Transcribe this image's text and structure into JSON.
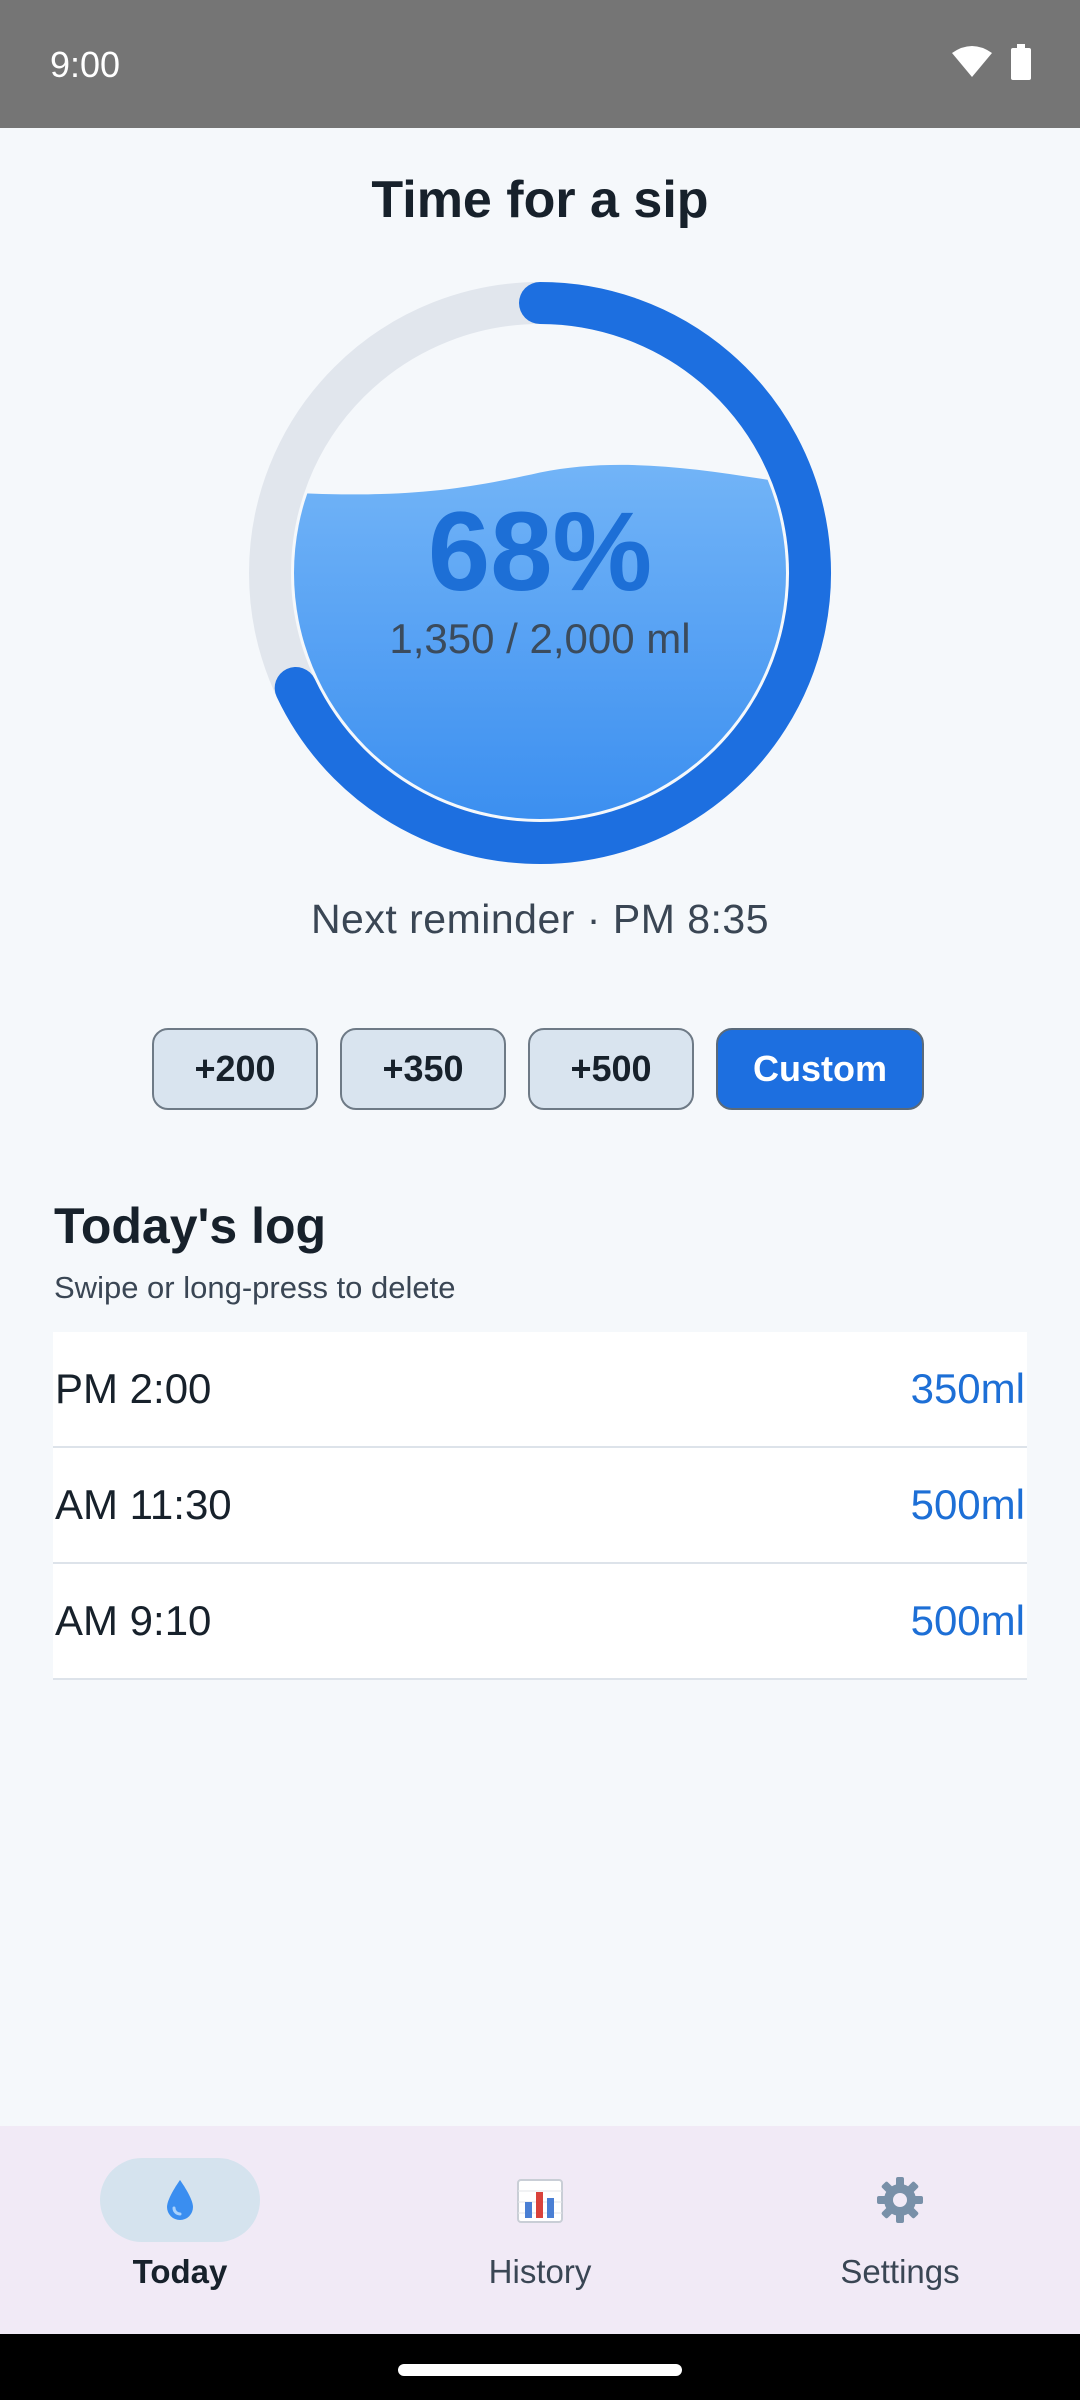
{
  "status_bar": {
    "time": "9:00"
  },
  "page": {
    "title": "Time for a sip"
  },
  "progress": {
    "percent_label": "68%",
    "fraction": 0.68,
    "amount_label": "1,350 / 2,000 ml",
    "next_reminder": "Next reminder · PM 8:35"
  },
  "quick_add": {
    "buttons": [
      "+200",
      "+350",
      "+500"
    ],
    "custom_label": "Custom"
  },
  "log": {
    "title": "Today's log",
    "subtitle": "Swipe or long-press to delete",
    "entries": [
      {
        "time": "PM 2:00",
        "amount": "350ml"
      },
      {
        "time": "AM 11:30",
        "amount": "500ml"
      },
      {
        "time": "AM 9:10",
        "amount": "500ml"
      }
    ]
  },
  "nav": {
    "items": [
      {
        "label": "Today",
        "icon": "water-drop-icon",
        "active": true
      },
      {
        "label": "History",
        "icon": "bar-chart-icon",
        "active": false
      },
      {
        "label": "Settings",
        "icon": "gear-icon",
        "active": false
      }
    ]
  },
  "colors": {
    "accent": "#1d6fe0",
    "track": "#e1e6ed",
    "water_top": "#72b4f7",
    "water_bottom": "#3a8ef0"
  }
}
